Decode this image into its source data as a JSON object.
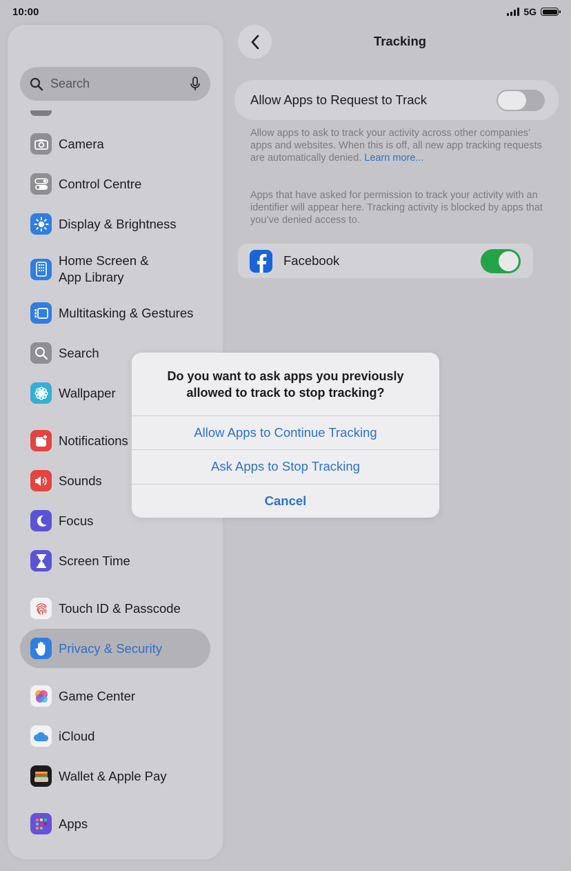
{
  "status": {
    "time": "10:00",
    "network": "5G"
  },
  "sidebar": {
    "search_placeholder": "Search",
    "items": [
      {
        "label": "Camera",
        "icon": "camera-icon",
        "color": "#8e8e93"
      },
      {
        "label": "Control Centre",
        "icon": "toggles-icon",
        "color": "#8e8e93"
      },
      {
        "label": "Display & Brightness",
        "icon": "sun-icon",
        "color": "#2f7ee0"
      },
      {
        "label": "Home Screen &",
        "label2": "App Library",
        "icon": "home-screen-icon",
        "color": "#2f7ee0"
      },
      {
        "label": "Multitasking & Gestures",
        "icon": "multitasking-icon",
        "color": "#2f7ee0"
      },
      {
        "label": "Search",
        "icon": "magnifier-icon",
        "color": "#8e8e93"
      },
      {
        "label": "Wallpaper",
        "icon": "flower-icon",
        "color": "#35aed6"
      },
      {
        "label": "Notifications",
        "icon": "bell-icon",
        "color": "#e5433f"
      },
      {
        "label": "Sounds",
        "icon": "speaker-icon",
        "color": "#e5433f"
      },
      {
        "label": "Focus",
        "icon": "moon-icon",
        "color": "#5b53d6"
      },
      {
        "label": "Screen Time",
        "icon": "hourglass-icon",
        "color": "#5b53d6"
      },
      {
        "label": "Touch ID & Passcode",
        "icon": "fingerprint-icon",
        "color": "#e5433f"
      },
      {
        "label": "Privacy & Security",
        "icon": "hand-icon",
        "color": "#2f7ee0"
      },
      {
        "label": "Game Center",
        "icon": "game-center-icon",
        "color": "#e0468e"
      },
      {
        "label": "iCloud",
        "icon": "cloud-icon",
        "color": "#3a8ee6"
      },
      {
        "label": "Wallet & Apple Pay",
        "icon": "wallet-icon",
        "color": "#1c1c1e"
      },
      {
        "label": "Apps",
        "icon": "apps-grid-icon",
        "color": "#6a4fd8"
      }
    ]
  },
  "detail": {
    "title": "Tracking",
    "allow_label": "Allow Apps to Request to Track",
    "desc1": "Allow apps to ask to track your activity across other companies’ apps and websites. When this is off, all new app tracking requests are automatically denied.",
    "learn_more": "Learn more...",
    "desc2": "Apps that have asked for permission to track your activity with an identifier will appear here. Tracking activity is blocked by apps that you’ve denied access to.",
    "app_label": "Facebook"
  },
  "alert": {
    "title": "Do you want to ask apps you previously allowed to track to stop tracking?",
    "continue": "Allow Apps to Continue Tracking",
    "stop": "Ask Apps to Stop Tracking",
    "cancel": "Cancel"
  }
}
